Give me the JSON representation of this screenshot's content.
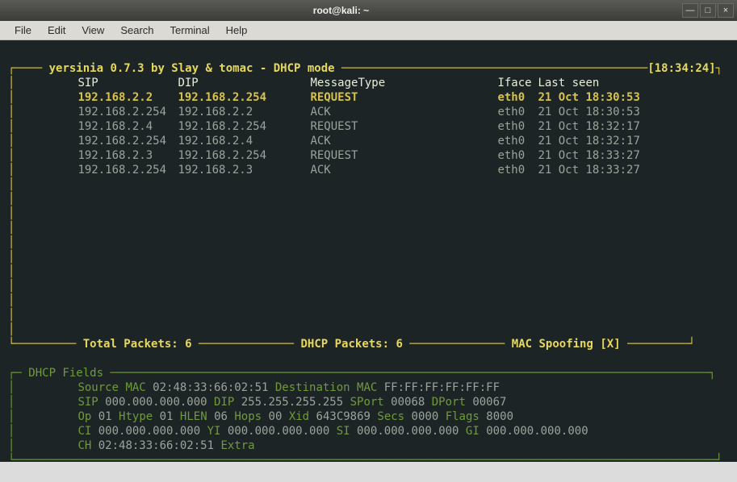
{
  "window": {
    "title": "root@kali: ~",
    "buttons": {
      "min": "—",
      "max": "□",
      "close": "×"
    }
  },
  "menu": [
    "File",
    "Edit",
    "View",
    "Search",
    "Terminal",
    "Help"
  ],
  "top_box": {
    "title_left": " yersinia 0.7.3 by Slay & tomac - DHCP mode ",
    "title_right": "[18:34:24]",
    "headers": {
      "sip": "SIP",
      "dip": "DIP",
      "msg": "MessageType",
      "iface": "Iface",
      "last": "Last seen"
    },
    "rows": [
      {
        "sip": "192.168.2.2",
        "dip": "192.168.2.254",
        "msg": "REQUEST",
        "iface": "eth0",
        "last": "21 Oct 18:30:53",
        "sel": true
      },
      {
        "sip": "192.168.2.254",
        "dip": "192.168.2.2",
        "msg": "ACK",
        "iface": "eth0",
        "last": "21 Oct 18:30:53",
        "sel": false
      },
      {
        "sip": "192.168.2.4",
        "dip": "192.168.2.254",
        "msg": "REQUEST",
        "iface": "eth0",
        "last": "21 Oct 18:32:17",
        "sel": false
      },
      {
        "sip": "192.168.2.254",
        "dip": "192.168.2.4",
        "msg": "ACK",
        "iface": "eth0",
        "last": "21 Oct 18:32:17",
        "sel": false
      },
      {
        "sip": "192.168.2.3",
        "dip": "192.168.2.254",
        "msg": "REQUEST",
        "iface": "eth0",
        "last": "21 Oct 18:33:27",
        "sel": false
      },
      {
        "sip": "192.168.2.254",
        "dip": "192.168.2.3",
        "msg": "ACK",
        "iface": "eth0",
        "last": "21 Oct 18:33:27",
        "sel": false
      }
    ],
    "footer": {
      "total_label": " Total Packets: ",
      "total_val": "6 ",
      "dhcp_label": " DHCP Packets: ",
      "dhcp_val": "6 ",
      "mac_label": " MAC Spoofing [X] "
    }
  },
  "fields_box": {
    "title": " DHCP Fields ",
    "lines": [
      [
        {
          "k": "Source MAC",
          "v": "02:48:33:66:02:51"
        },
        {
          "k": "Destination MAC",
          "v": "FF:FF:FF:FF:FF:FF"
        }
      ],
      [
        {
          "k": "SIP",
          "v": "000.000.000.000"
        },
        {
          "k": "DIP",
          "v": "255.255.255.255"
        },
        {
          "k": "SPort",
          "v": "00068"
        },
        {
          "k": "DPort",
          "v": "00067"
        }
      ],
      [
        {
          "k": "Op",
          "v": "01"
        },
        {
          "k": "Htype",
          "v": "01"
        },
        {
          "k": "HLEN",
          "v": "06"
        },
        {
          "k": "Hops",
          "v": "00"
        },
        {
          "k": "Xid",
          "v": "643C9869"
        },
        {
          "k": "Secs",
          "v": "0000"
        },
        {
          "k": "Flags",
          "v": "8000"
        }
      ],
      [
        {
          "k": "CI",
          "v": "000.000.000.000"
        },
        {
          "k": "YI",
          "v": "000.000.000.000"
        },
        {
          "k": "SI",
          "v": "000.000.000.000"
        },
        {
          "k": "GI",
          "v": "000.000.000.000"
        }
      ],
      [
        {
          "k": "CH",
          "v": "02:48:33:66:02:51"
        },
        {
          "k": "Extra",
          "v": ""
        }
      ]
    ]
  }
}
